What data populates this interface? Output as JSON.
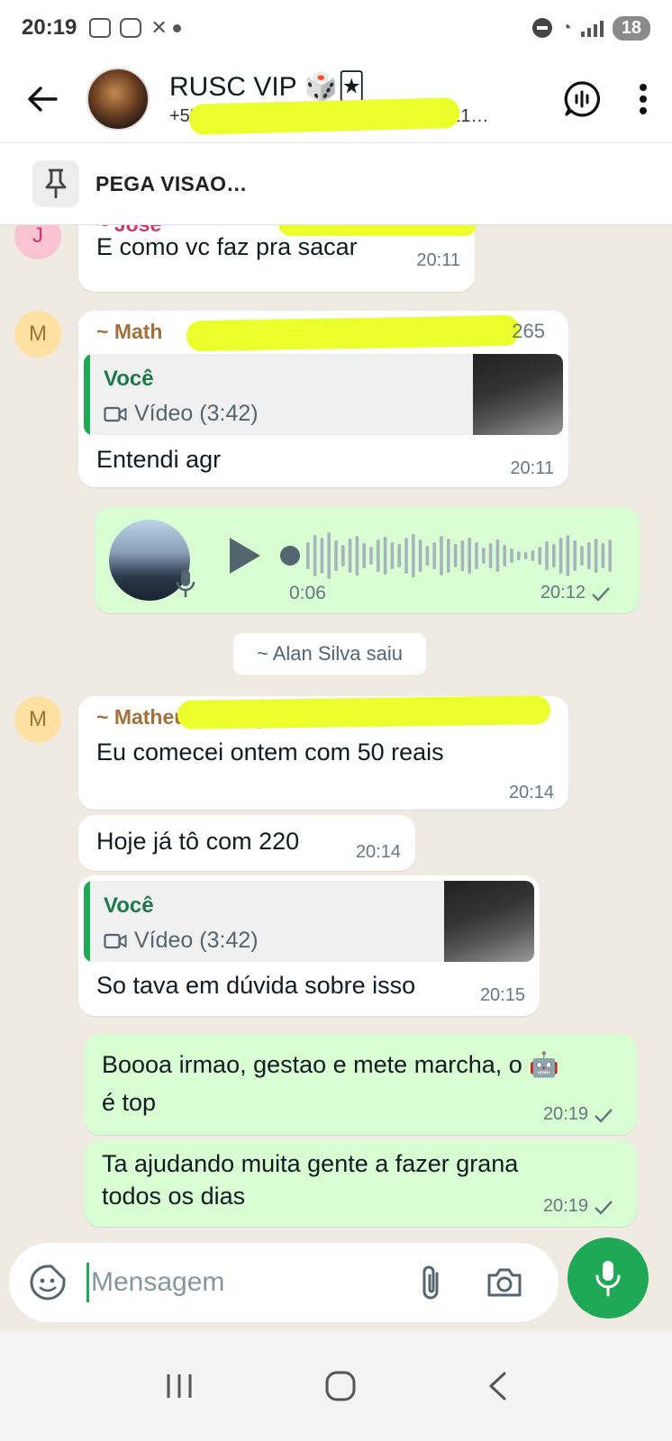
{
  "status_bar": {
    "time": "20:19",
    "battery": "18"
  },
  "header": {
    "title": "RUSC VIP 🎲🃏",
    "subtitle": "+55 ",
    "subtitle_tail": "8221…"
  },
  "pinned": {
    "text": "PEGA VISAO…"
  },
  "messages": [
    {
      "sender": "~ José",
      "avatar_letter": "J",
      "text": "E como vc faz pra sacar",
      "time": "20:11"
    },
    {
      "sender": "~ Math",
      "sender_tail": "265",
      "avatar_letter": "M",
      "quote": {
        "author": "Você",
        "media": "Vídeo (3:42)"
      },
      "text": "Entendi agr",
      "time": "20:11"
    },
    {
      "type": "voice",
      "duration": "0:06",
      "time": "20:12"
    },
    {
      "type": "system",
      "text": "~ Alan Silva saiu"
    },
    {
      "sender": "~ Matheus Albuq",
      "avatar_letter": "M",
      "text": "Eu comecei ontem com 50 reais",
      "time": "20:14"
    },
    {
      "text": "Hoje já tô com 220",
      "time": "20:14"
    },
    {
      "quote": {
        "author": "Você",
        "media": "Vídeo (3:42)"
      },
      "text": "So tava em dúvida sobre isso",
      "time": "20:15"
    },
    {
      "outgoing": true,
      "text_line1": "Boooa irmao, gestao e mete marcha, o 🤖",
      "text_line2": "é top",
      "time": "20:19"
    },
    {
      "outgoing": true,
      "text_line1": "Ta ajudando muita gente a fazer grana",
      "text_line2": "todos os dias",
      "time": "20:19"
    }
  ],
  "input": {
    "placeholder": "Mensagem"
  },
  "colors": {
    "accent": "#1fa855",
    "outgoing_bubble": "#d9fdd3",
    "sender_j": "#d6336c",
    "sender_m": "#a2703a",
    "redaction": "#eaff2b"
  },
  "icons": [
    "back-arrow-icon",
    "voice-chat-icon",
    "more-vert-icon",
    "pin-icon",
    "play-icon",
    "mic-icon",
    "sticker-icon",
    "attach-icon",
    "camera-icon",
    "check-icon",
    "video-icon"
  ]
}
